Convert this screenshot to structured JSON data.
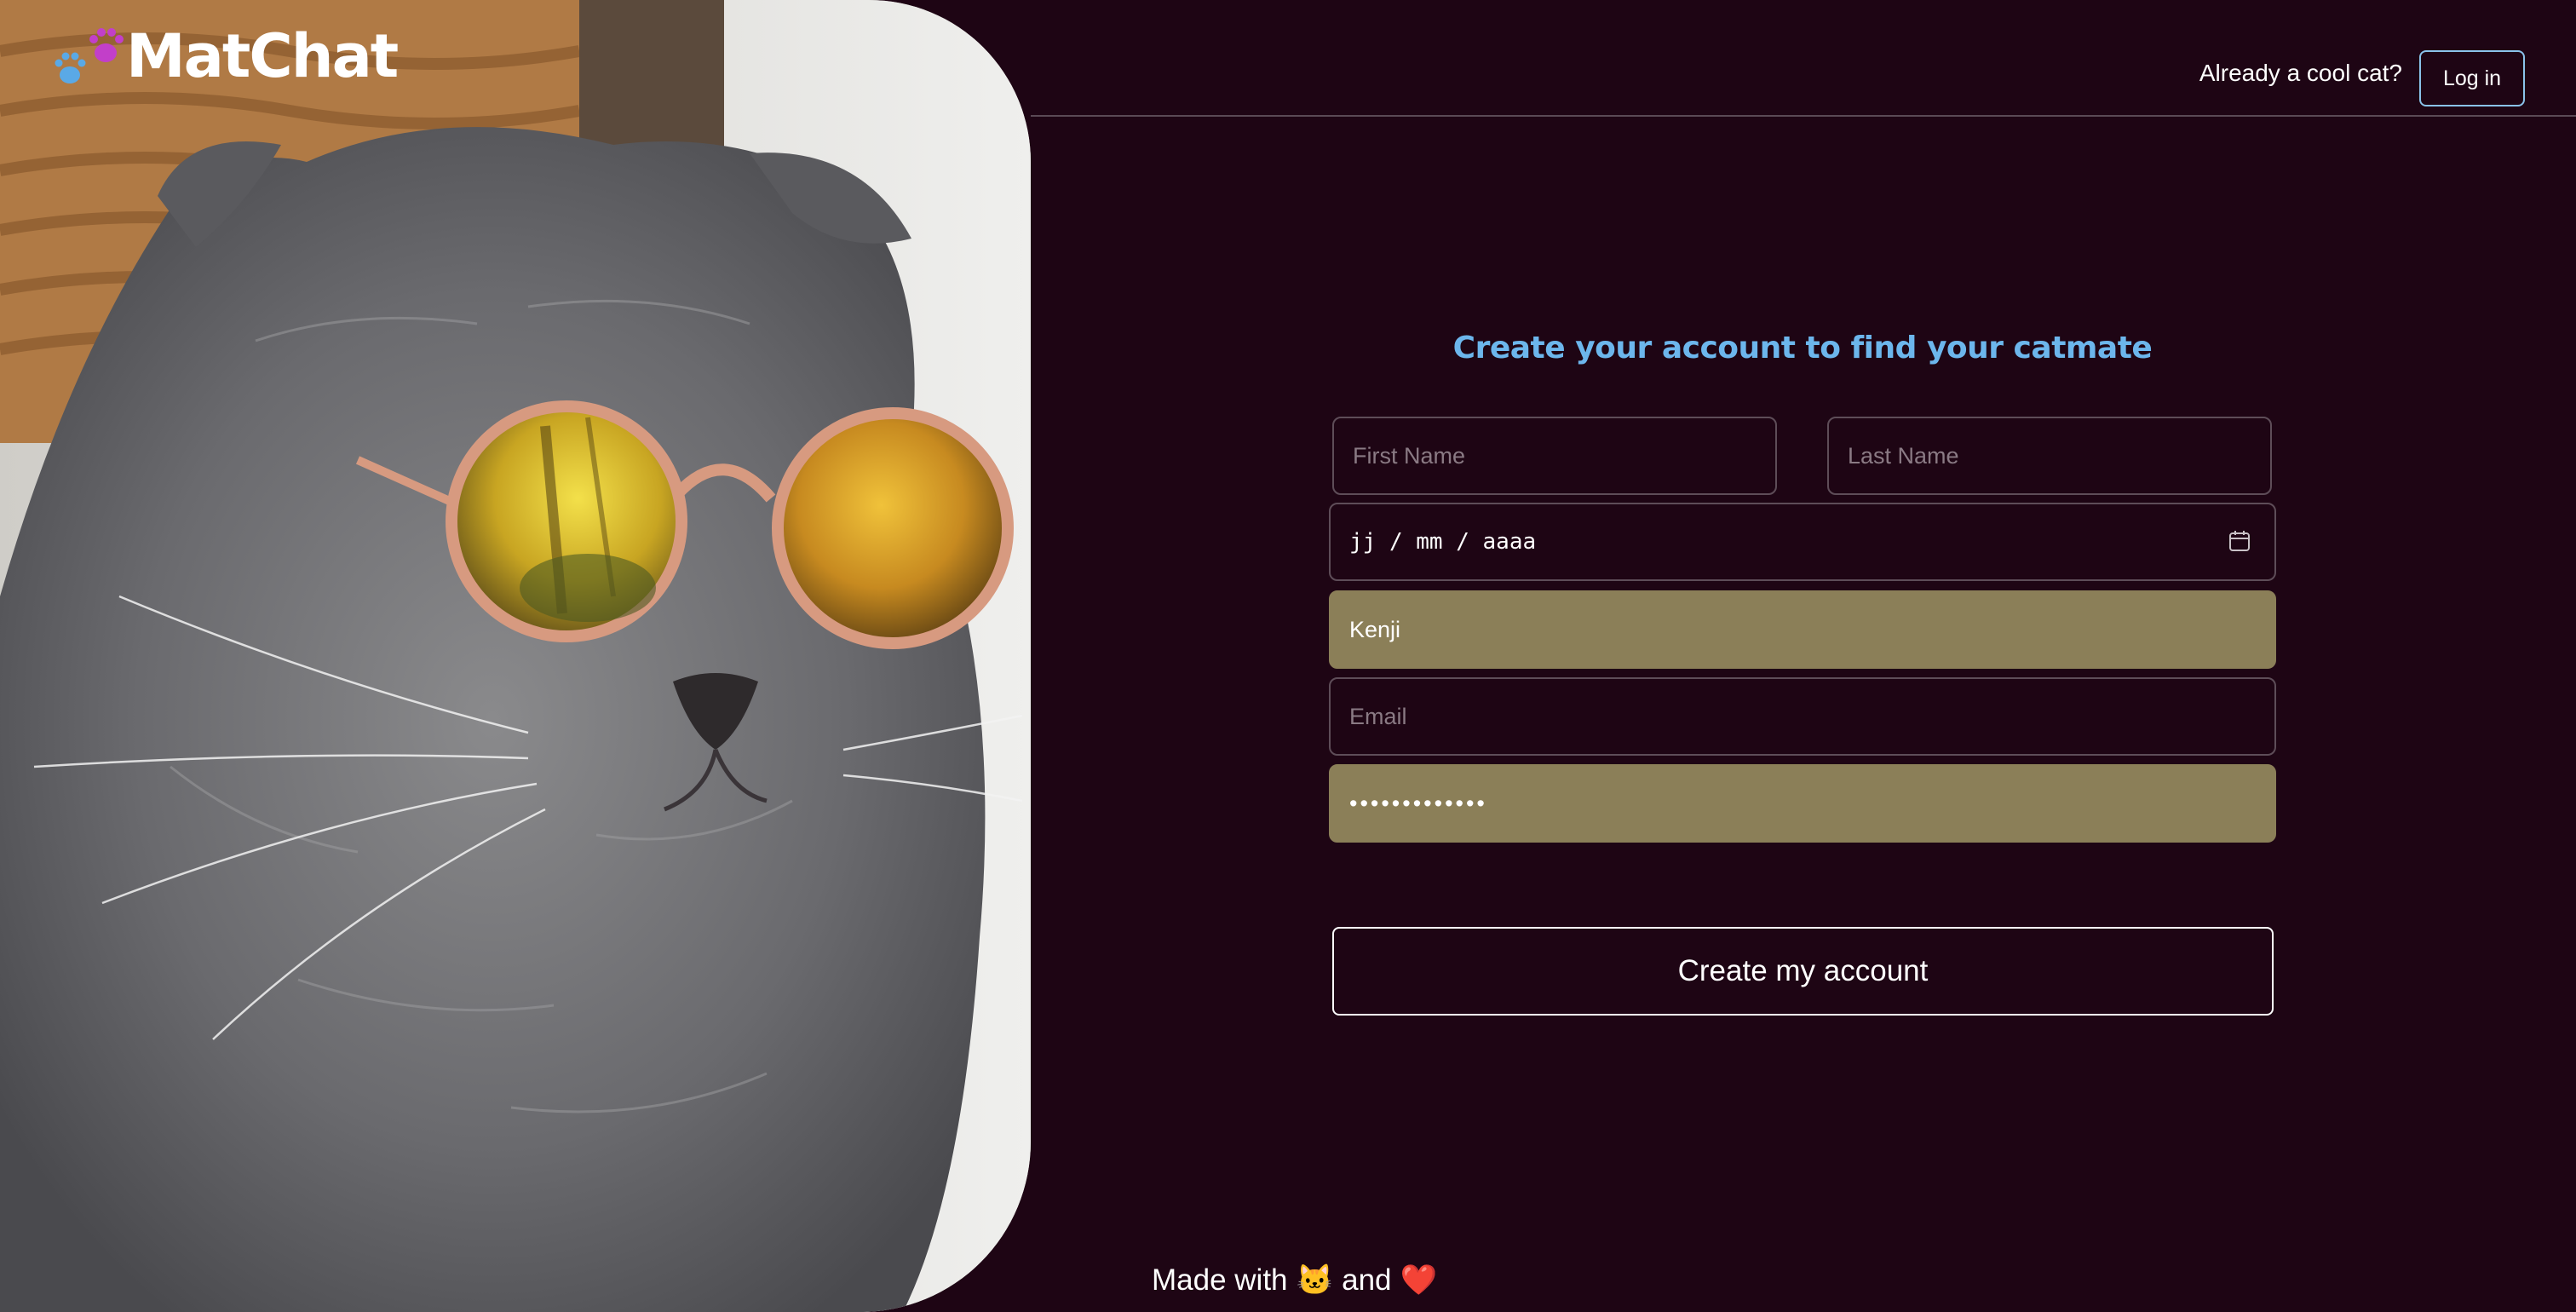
{
  "brand": {
    "name": "MatChat",
    "paw_colors": [
      "#c23fc9",
      "#5aa9e6"
    ]
  },
  "header": {
    "login_prompt": "Already a cool cat?",
    "login_label": "Log in",
    "login_border_color": "#8ac2ea"
  },
  "form": {
    "title": "Create your account to find your catmate",
    "title_color": "#6cb6ec",
    "first_name": {
      "placeholder": "First Name",
      "value": ""
    },
    "last_name": {
      "placeholder": "Last Name",
      "value": ""
    },
    "birthdate": {
      "display": "jj / mm / aaaa",
      "icon": "calendar-icon"
    },
    "username": {
      "value": "Kenji",
      "autofilled": true
    },
    "email": {
      "placeholder": "Email",
      "value": ""
    },
    "password": {
      "masked": "•••••••••••••",
      "autofilled": true
    },
    "submit_label": "Create my account"
  },
  "footer": {
    "prefix": "Made with",
    "cat_emoji": "🐱",
    "middle": "and",
    "heart_emoji": "❤️"
  },
  "colors": {
    "background": "#1e0514",
    "autofill": "#8b7f58"
  }
}
